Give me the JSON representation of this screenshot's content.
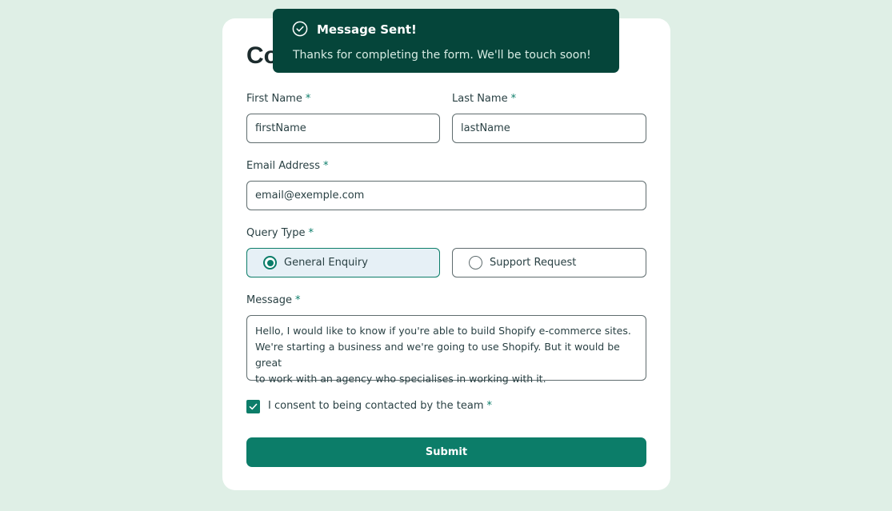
{
  "form": {
    "title": "Contact Us",
    "required_mark": "*",
    "first_name": {
      "label": "First Name",
      "value": "firstName"
    },
    "last_name": {
      "label": "Last Name",
      "value": "lastName"
    },
    "email": {
      "label": "Email Address",
      "value": "email@exemple.com"
    },
    "query_type": {
      "label": "Query Type",
      "options": [
        {
          "label": "General Enquiry",
          "selected": true
        },
        {
          "label": "Support Request",
          "selected": false
        }
      ]
    },
    "message": {
      "label": "Message",
      "value": "Hello, I would like to know if you're able to build Shopify e-commerce sites.\nWe're starting a business and we're going to use Shopify. But it would be great\nto work with an agency who specialises in working with it."
    },
    "consent": {
      "label": "I consent to being contacted by the team",
      "checked": true
    },
    "submit_label": "Submit"
  },
  "toast": {
    "title": "Message Sent!",
    "text": "Thanks for completing the form. We'll be touch soon!"
  },
  "colors": {
    "page_bg": "#dfefe6",
    "accent": "#0c7d69",
    "toast_bg": "#05453a",
    "selected_bg": "#e6f0f6"
  }
}
